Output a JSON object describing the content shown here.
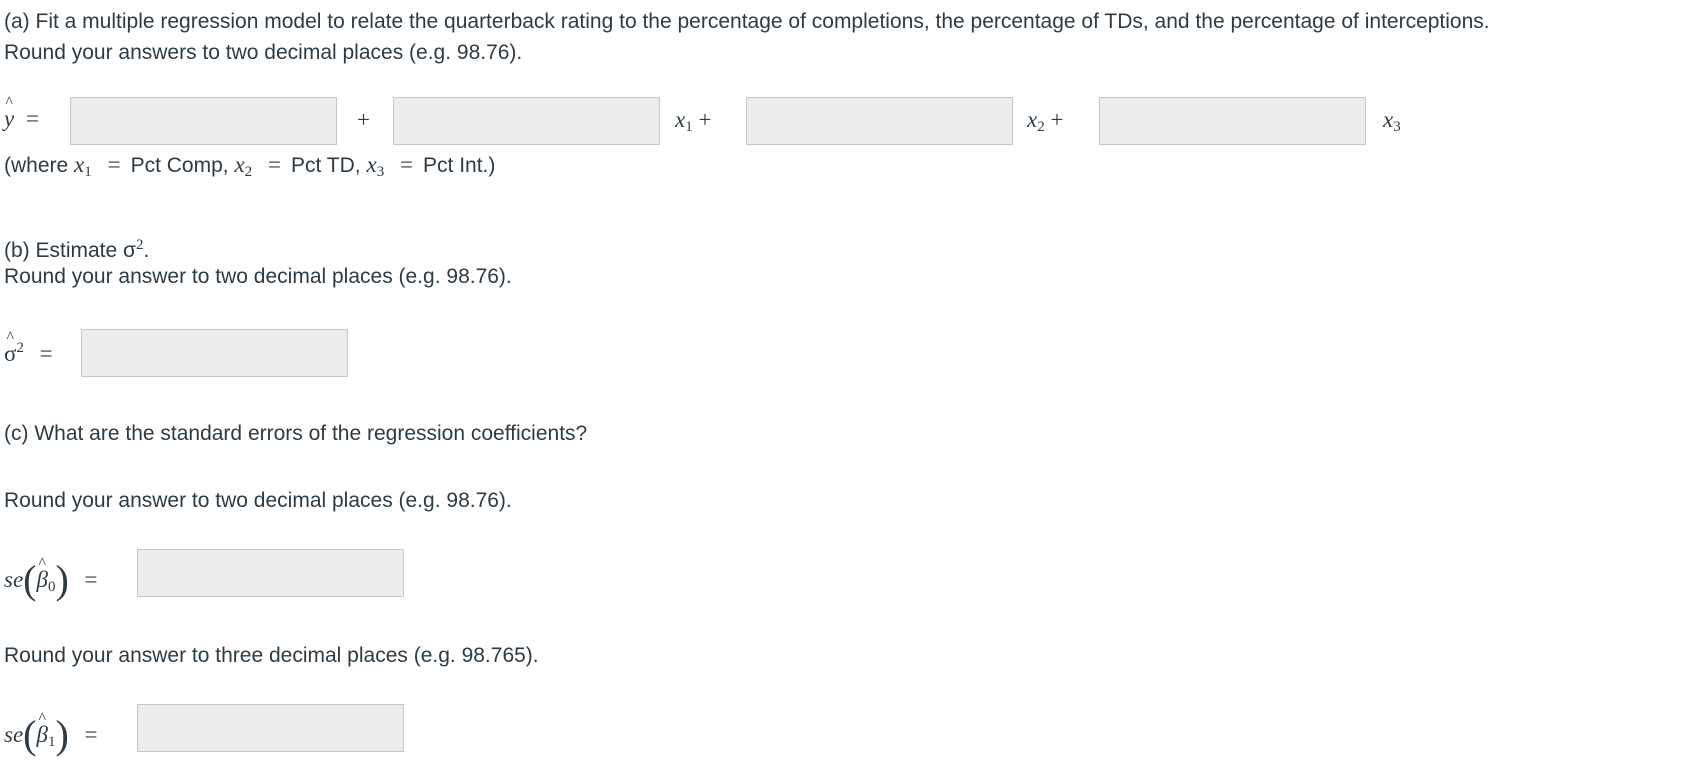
{
  "part_a": {
    "prompt": "(a) Fit a multiple regression model to relate the quarterback rating to the percentage of completions, the percentage of TDs, and the percentage of interceptions.",
    "rounding": "Round your answers to two decimal places (e.g. 98.76).",
    "equation": {
      "lhs": "y",
      "equals": "=",
      "plus": "+",
      "var_x": "x",
      "sub1": "1",
      "sub2": "2",
      "sub3": "3",
      "inputs": [
        {
          "name": "intercept",
          "value": "",
          "placeholder": ""
        },
        {
          "name": "coef-x1",
          "value": "",
          "placeholder": ""
        },
        {
          "name": "coef-x2",
          "value": "",
          "placeholder": ""
        },
        {
          "name": "coef-x3",
          "value": "",
          "placeholder": ""
        }
      ]
    },
    "where": {
      "open": "(where ",
      "x1_label": "Pct Comp,",
      "x2_label": "Pct TD,",
      "x3_label": "Pct Int.)"
    }
  },
  "part_b": {
    "prompt": "(b) Estimate σ",
    "prompt_sup": "2",
    "prompt_end": ".",
    "rounding": "Round your answer to two decimal places (e.g. 98.76).",
    "lhs": "σ",
    "lhs_sup": "2",
    "input": {
      "value": "",
      "placeholder": ""
    }
  },
  "part_c": {
    "prompt": "(c) What are the standard errors of the regression coefficients?",
    "items": [
      {
        "rounding": "Round your answer to two decimal places (e.g. 98.76).",
        "label": "se",
        "beta": "β",
        "sub": "0",
        "value": ""
      },
      {
        "rounding": "Round your answer to three decimal places (e.g. 98.765).",
        "label": "se",
        "beta": "β",
        "sub": "1",
        "value": ""
      }
    ]
  },
  "symbols": {
    "hat": "^",
    "open_paren": "(",
    "close_paren": ")",
    "equals": "="
  }
}
